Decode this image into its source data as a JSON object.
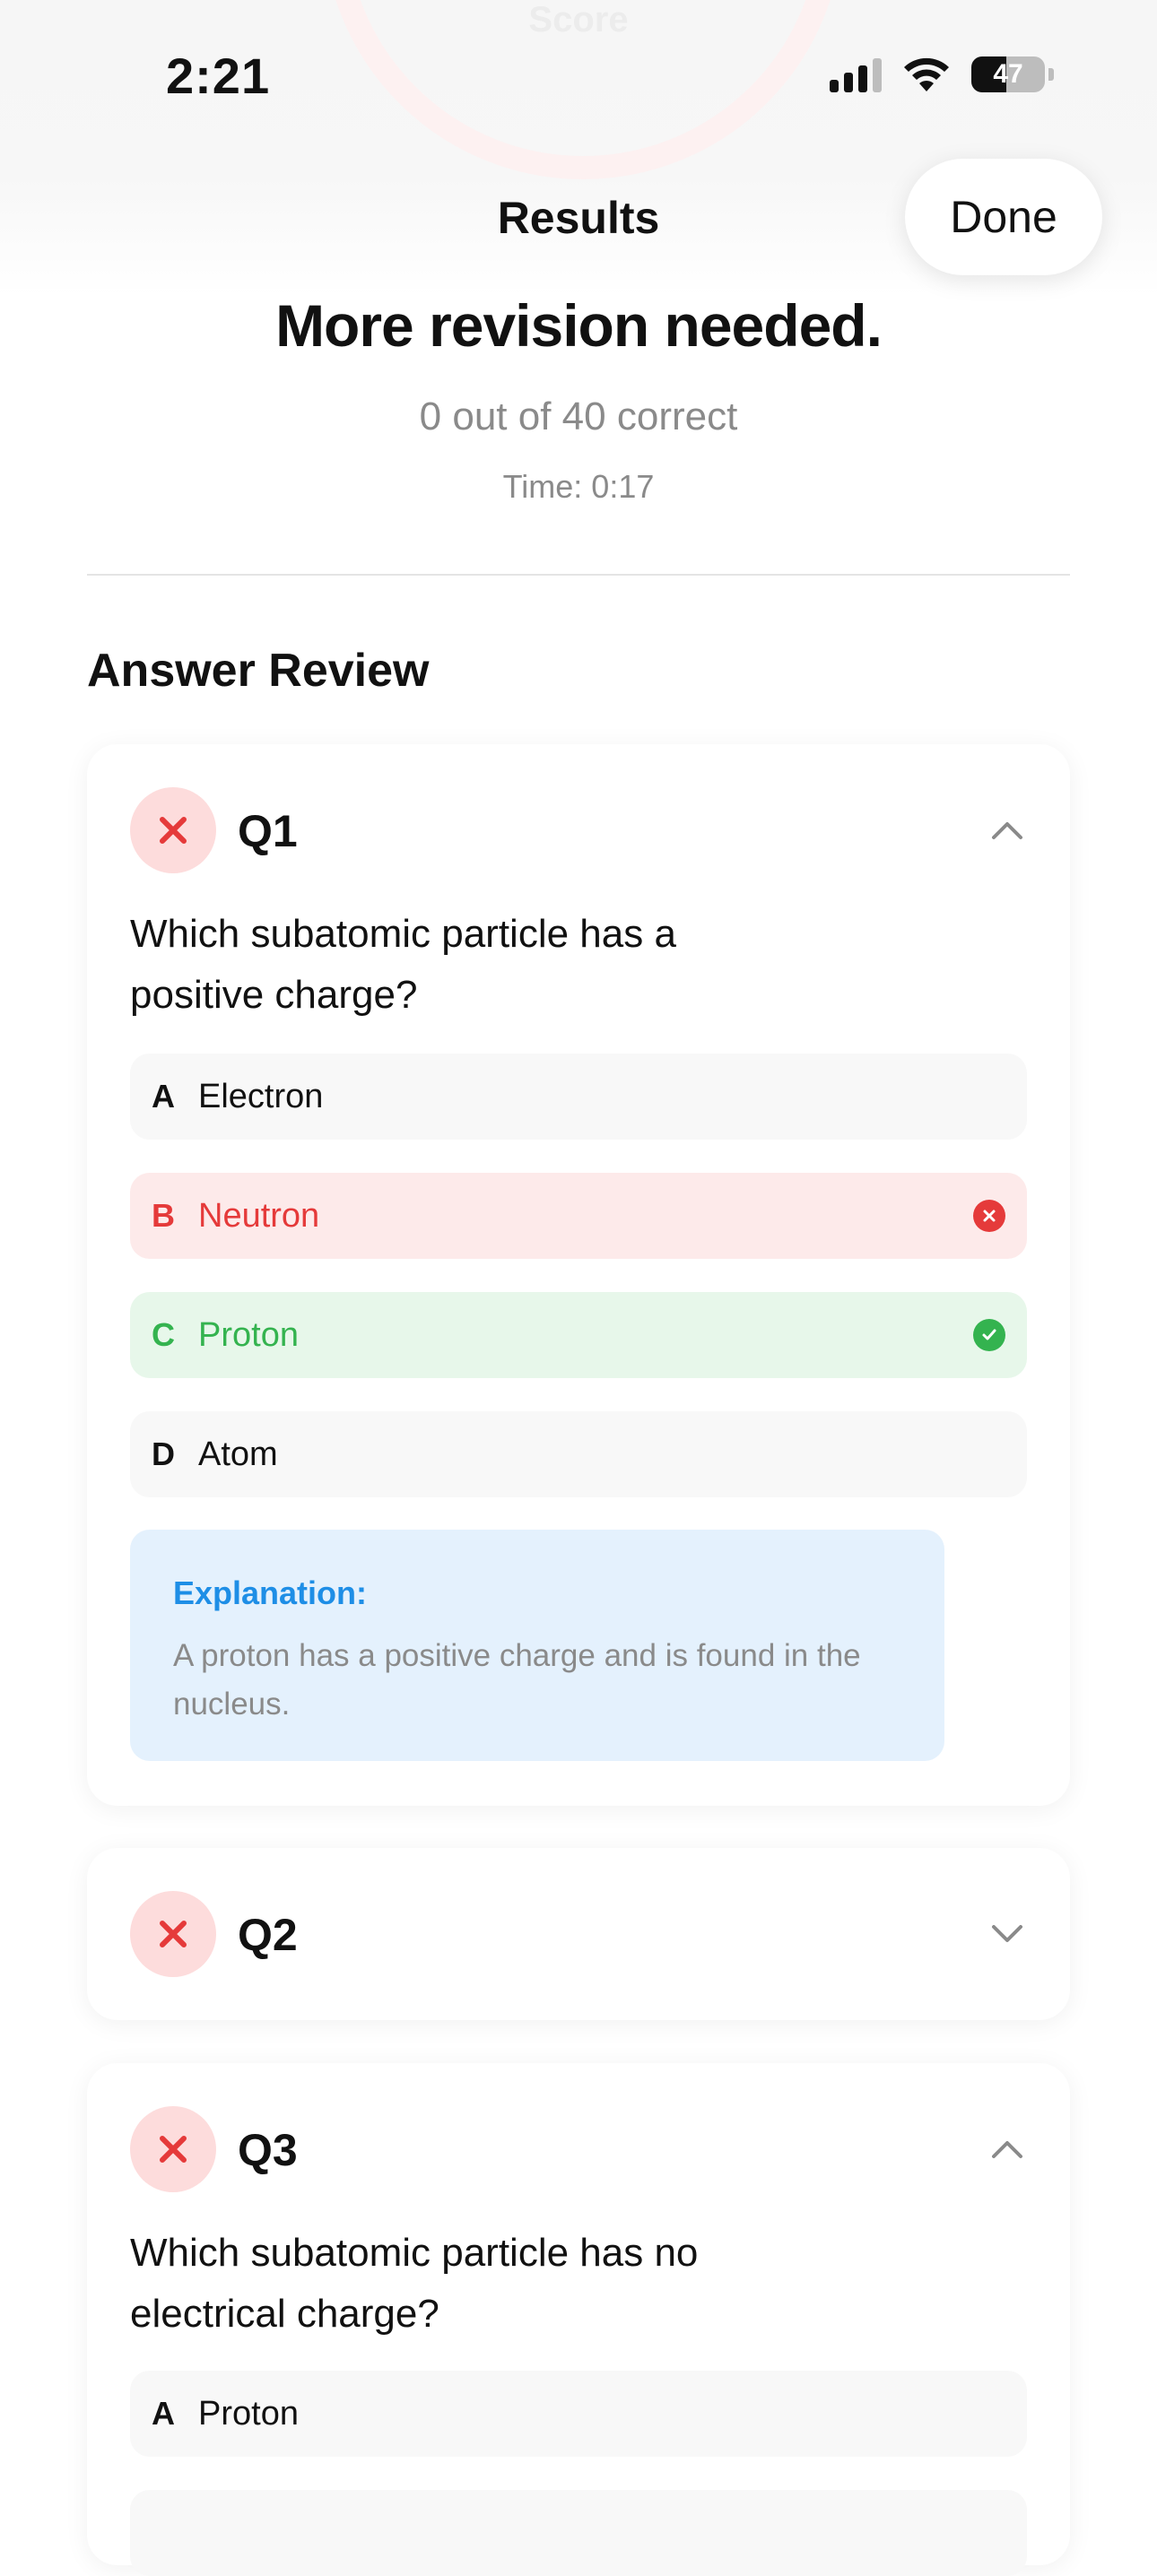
{
  "background_ring": {
    "label": "Score"
  },
  "status_bar": {
    "time": "2:21",
    "battery": "47"
  },
  "nav": {
    "title": "Results",
    "done_label": "Done"
  },
  "summary": {
    "headline": "More revision needed.",
    "score": "0 out of 40 correct",
    "time": "Time: 0:17"
  },
  "review": {
    "section_title": "Answer Review",
    "questions": [
      {
        "number": "Q1",
        "expanded": true,
        "question": "Which subatomic particle has a positive charge?",
        "options": [
          {
            "letter": "A",
            "text": "Electron",
            "state": "neutral"
          },
          {
            "letter": "B",
            "text": "Neutron",
            "state": "selected-wrong"
          },
          {
            "letter": "C",
            "text": "Proton",
            "state": "correct"
          },
          {
            "letter": "D",
            "text": "Atom",
            "state": "neutral"
          }
        ],
        "explanation_title": "Explanation:",
        "explanation": "A proton has a positive charge and is found in the nucleus."
      },
      {
        "number": "Q2",
        "expanded": false
      },
      {
        "number": "Q3",
        "expanded": true,
        "question": "Which subatomic particle has no electrical charge?",
        "options": [
          {
            "letter": "A",
            "text": "Proton",
            "state": "neutral"
          }
        ]
      }
    ]
  },
  "colors": {
    "wrong": "#e53a3a",
    "correct": "#34b34f",
    "explanation_title": "#1e8ee6",
    "muted_text": "#8a8a8a"
  }
}
